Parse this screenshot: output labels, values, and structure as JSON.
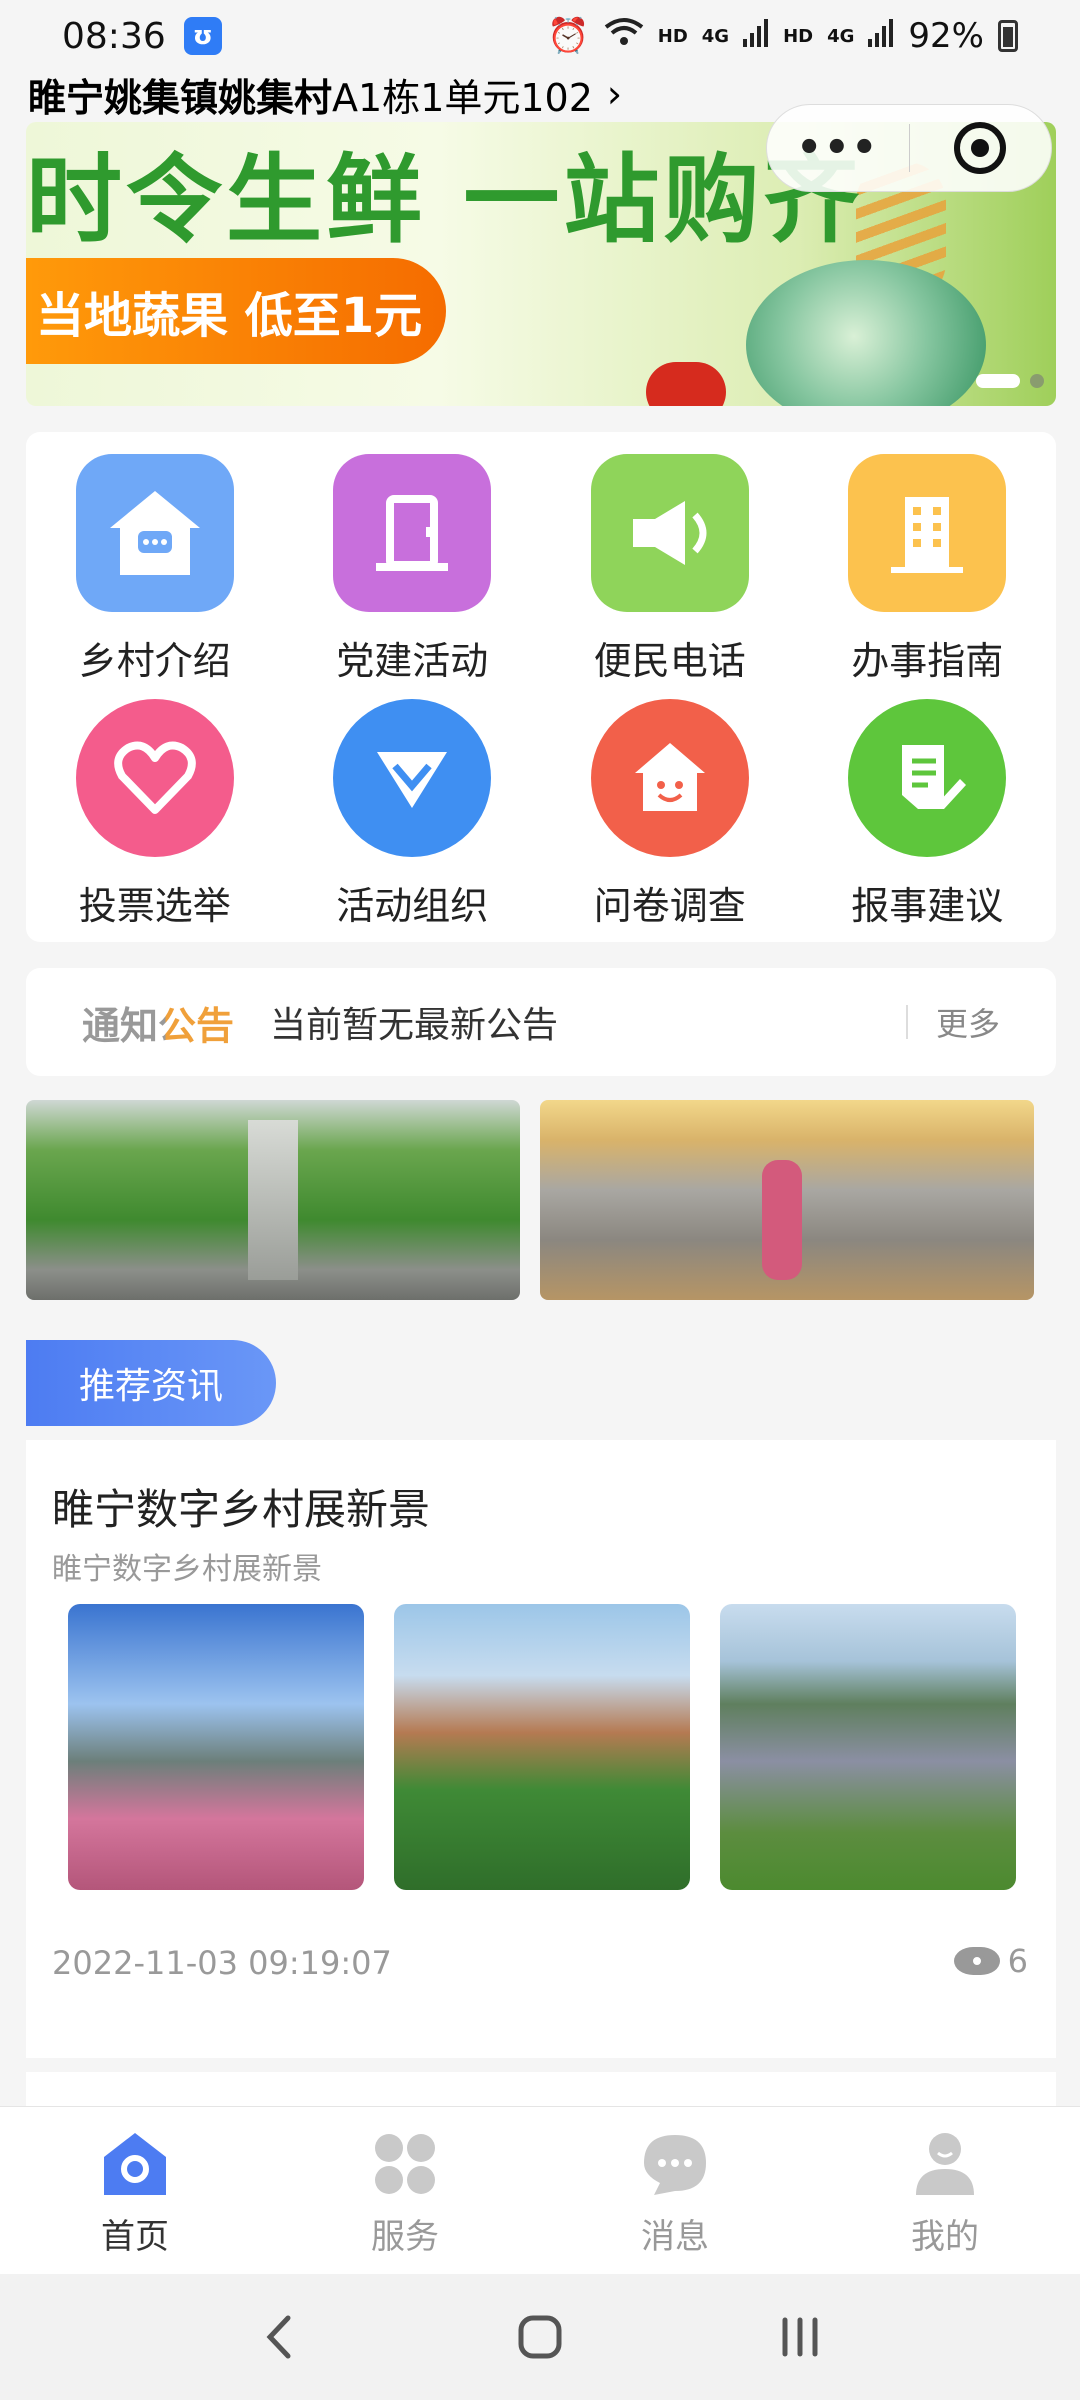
{
  "status_bar": {
    "time": "08:36",
    "battery": "92%",
    "hd1": "HD",
    "net1": "4G",
    "hd2": "HD",
    "net2": "4G"
  },
  "header": {
    "location_bold": "睢宁姚集镇姚集村",
    "location_detail": "A1栋1单元102",
    "chevron": "›",
    "capsule_more": "•••"
  },
  "banner": {
    "headline": "时令生鲜 一站购齐",
    "promo": "当地蔬果 低至1元",
    "active_slide": 1,
    "slide_count": 2
  },
  "grid": {
    "items": [
      {
        "label": "乡村介绍",
        "icon": "village-house-icon",
        "color": "#6fa8f7"
      },
      {
        "label": "党建活动",
        "icon": "door-icon",
        "color": "#c86fdc"
      },
      {
        "label": "便民电话",
        "icon": "megaphone-icon",
        "color": "#8fd45a"
      },
      {
        "label": "办事指南",
        "icon": "building-icon",
        "color": "#fcc24e"
      },
      {
        "label": "投票选举",
        "icon": "heart-icon",
        "color": "#f45c8c"
      },
      {
        "label": "活动组织",
        "icon": "diamond-icon",
        "color": "#3f8ff2"
      },
      {
        "label": "问卷调查",
        "icon": "smiley-house-icon",
        "color": "#f2604a"
      },
      {
        "label": "报事建议",
        "icon": "document-edit-icon",
        "color": "#5ec63c"
      }
    ]
  },
  "notice": {
    "tag": "通知公告",
    "text": "当前暂无最新公告",
    "more": "更多"
  },
  "recommend": {
    "tab_label": "推荐资讯"
  },
  "news": {
    "title": "睢宁数字乡村展新景",
    "subtitle": "睢宁数字乡村展新景",
    "time": "2022-11-03 09:19:07",
    "views": "6"
  },
  "tab_bar": {
    "tabs": [
      {
        "label": "首页",
        "icon": "home-icon",
        "active": true
      },
      {
        "label": "服务",
        "icon": "services-icon",
        "active": false
      },
      {
        "label": "消息",
        "icon": "message-icon",
        "active": false
      },
      {
        "label": "我的",
        "icon": "profile-icon",
        "active": false
      }
    ]
  },
  "colors": {
    "accent": "#4d7cf2",
    "banner_green": "#2f9a2e",
    "promo_orange": "#f56c00"
  }
}
